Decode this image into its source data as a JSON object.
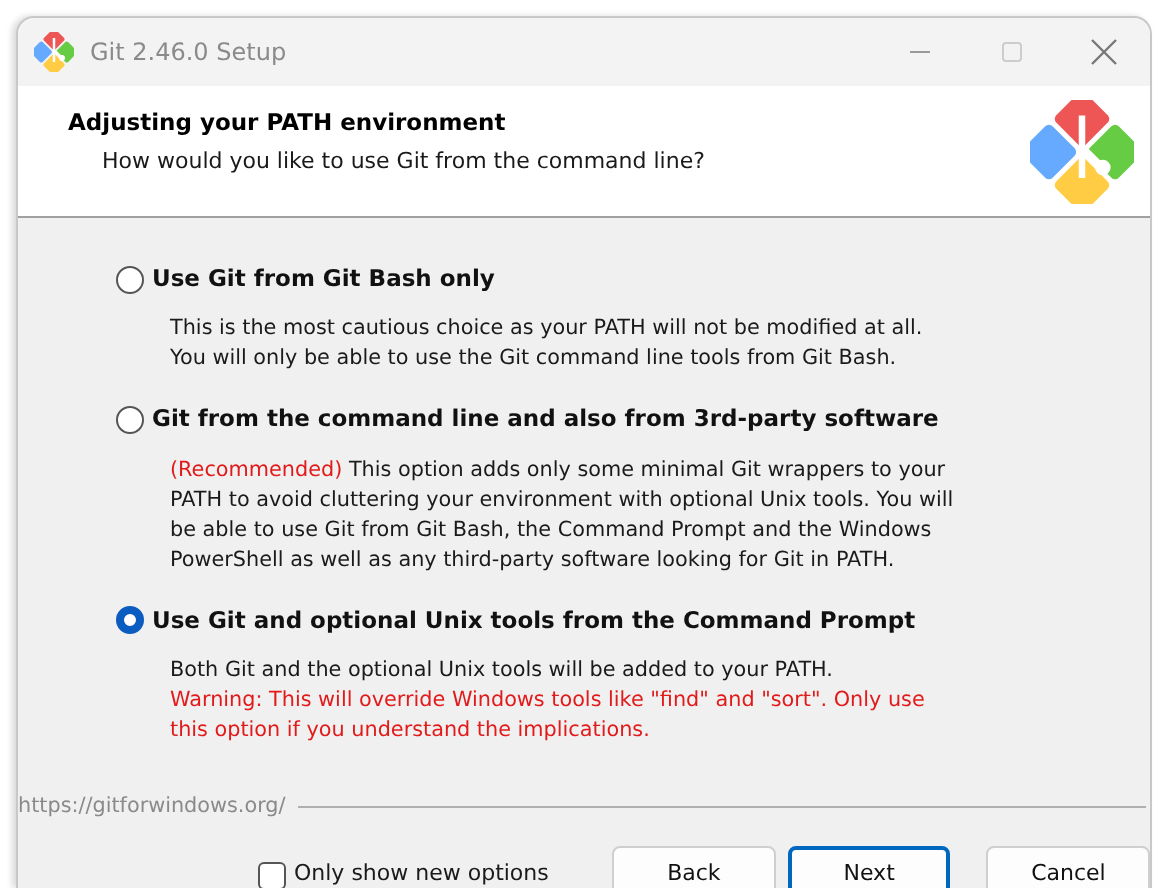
{
  "window": {
    "title": "Git 2.46.0 Setup",
    "active": false
  },
  "header": {
    "title": "Adjusting your PATH environment",
    "subtitle": "How would you like to use Git from the command line?"
  },
  "options": [
    {
      "label": "Use Git from Git Bash only",
      "selected": false,
      "description": "This is the most cautious choice as your PATH will not be modified at all. You will only be able to use the Git command line tools from Git Bash."
    },
    {
      "label": "Git from the command line and also from 3rd-party software",
      "selected": false,
      "note": "(Recommended)",
      "description": "This option adds only some minimal Git wrappers to your PATH to avoid cluttering your environment with optional Unix tools. You will be able to use Git from Git Bash, the Command Prompt and the Windows PowerShell as well as any third-party software looking for Git in PATH."
    },
    {
      "label": "Use Git and optional Unix tools from the Command Prompt",
      "selected": true,
      "description": "Both Git and the optional Unix tools will be added to your PATH.",
      "warning": "Warning: This will override Windows tools like \"find\" and \"sort\". Only use this option if you understand the implications."
    }
  ],
  "footer": {
    "url": "https://gitforwindows.org/",
    "only_new": {
      "label": "Only show new options",
      "checked": false
    },
    "buttons": [
      {
        "label": "Back",
        "focused": false
      },
      {
        "label": "Next",
        "focused": true
      },
      {
        "label": "Cancel",
        "focused": false
      }
    ]
  }
}
